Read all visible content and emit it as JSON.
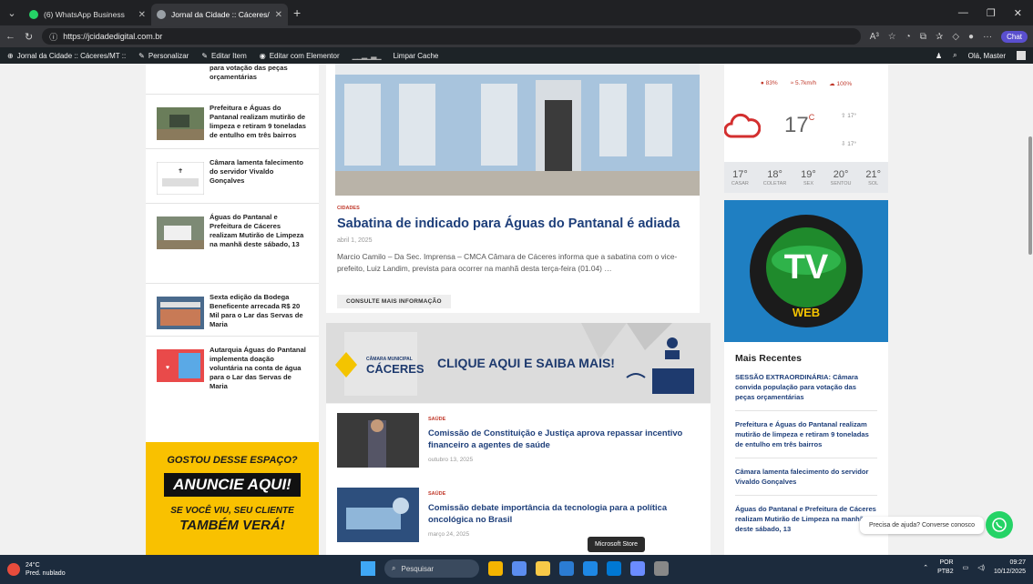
{
  "browser": {
    "tabs": [
      {
        "label": "(6) WhatsApp Business",
        "color": "#25d366"
      },
      {
        "label": "Jornal da Cidade :: Cáceres/MT :: ·",
        "color": "#9aa0a6"
      }
    ],
    "url": "https://jcidadedigital.com.br",
    "chat_label": "Chat",
    "reader_mode": "A³"
  },
  "wpbar": {
    "site": "Jornal da Cidade :: Cáceres/MT ::",
    "personalize": "Personalizar",
    "edit_item": "Editar Item",
    "edit_elementor": "Editar com Elementor",
    "clear_cache": "Limpar Cache",
    "greeting": "Olá, Master"
  },
  "left_sidebar": {
    "items": [
      {
        "title": "para votação das peças orçamentárias"
      },
      {
        "title": "Prefeitura e Águas do Pantanal realizam mutirão de limpeza e retiram 9 toneladas de entulho em três bairros"
      },
      {
        "title": "Câmara lamenta falecimento do servidor Vivaldo Gonçalves",
        "thumb_text": "NOTA DE PESAR"
      },
      {
        "title": "Águas do Pantanal e Prefeitura de Cáceres realizam Mutirão de Limpeza na manhã deste sábado, 13"
      },
      {
        "title": "Sexta edição da Bodega Beneficente arrecada R$ 20 Mil para o Lar das Servas de Maria"
      },
      {
        "title": "Autarquia Águas do Pantanal implementa doação voluntária na conta de água para o Lar das Servas de Maria"
      }
    ],
    "ad": {
      "line1": "GOSTOU DESSE ESPAÇO?",
      "line2": "ANUNCIE AQUI!",
      "line3": "SE VOCÊ VIU, SEU CLIENTE",
      "line4": "TAMBÉM VERÁ!"
    }
  },
  "featured": {
    "category": "CIDADES",
    "title": "Sabatina de indicado para Águas do Pantanal é adiada",
    "date": "abril 1, 2025",
    "excerpt": "Marcio Camilo – Da Sec. Imprensa – CMCA   Câmara de Cáceres informa que a sabatina com o vice-prefeito, Luiz Landim, prevista para ocorrer na manhã desta terça-feira (01.04) …",
    "button": "CONSULTE MAIS INFORMAÇÃO"
  },
  "banner": {
    "logo_small": "CÂMARA MUNICIPAL",
    "logo_big": "CÁCERES",
    "cta": "CLIQUE AQUI E SAIBA MAIS!"
  },
  "news": [
    {
      "category": "SAÚDE",
      "title": "Comissão de Constituição e Justiça aprova repassar incentivo financeiro a agentes de saúde",
      "date": "outubro 13, 2025"
    },
    {
      "category": "SAÚDE",
      "title": "Comissão debate importância da tecnologia para a política oncológica no Brasil",
      "date": "março 24, 2025"
    }
  ],
  "weather": {
    "humidity": "83%",
    "wind": "5.7km/h",
    "clouds": "100%",
    "temp": "17",
    "unit": "C",
    "high": "17°",
    "low": "17°",
    "forecast": [
      {
        "t": "17°",
        "d": "CASAR"
      },
      {
        "t": "18°",
        "d": "COLETAR"
      },
      {
        "t": "19°",
        "d": "SEX"
      },
      {
        "t": "20°",
        "d": "SENTOU"
      },
      {
        "t": "21°",
        "d": "SOL"
      }
    ]
  },
  "tvweb": {
    "letters": "TV",
    "word": "WEB"
  },
  "recent": {
    "heading": "Mais Recentes",
    "items": [
      "SESSÃO EXTRAORDINÁRIA: Câmara convida população para votação das peças orçamentárias",
      "Prefeitura e Águas do Pantanal realizam mutirão de limpeza e retiram 9 toneladas de entulho em três bairros",
      "Câmara lamenta falecimento do servidor Vivaldo Gonçalves",
      "Águas do Pantanal e Prefeitura de Cáceres realizam Mutirão de Limpeza na manhã deste sábado, 13"
    ]
  },
  "whatsapp": {
    "label": "Precisa de ajuda? Converse conosco"
  },
  "tooltip": "Microsoft Store",
  "taskbar": {
    "temp": "24°C",
    "condition": "Pred. nublado",
    "search": "Pesquisar",
    "lang1": "POR",
    "lang2": "PTB2",
    "time": "09:27",
    "date": "10/12/2025"
  },
  "colors": {
    "accent": "#1e3f7a",
    "category": "#c0392b",
    "ad": "#f9c100",
    "tvweb": "#1f7fc2"
  }
}
